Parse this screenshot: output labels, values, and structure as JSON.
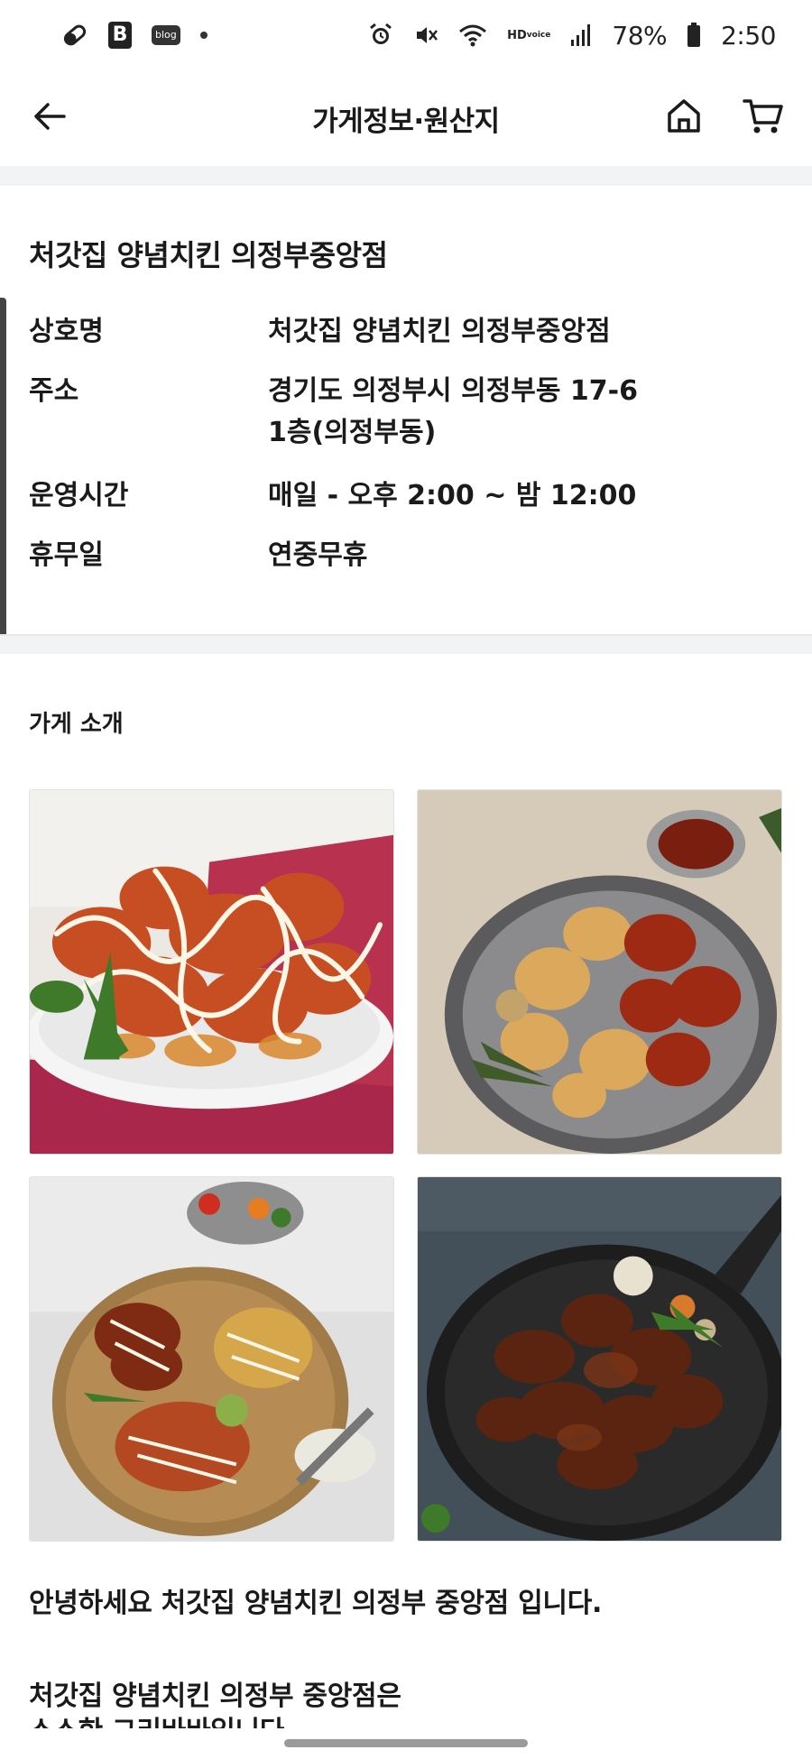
{
  "status_bar": {
    "left_icons": [
      "pill-icon",
      "b-app-icon",
      "blog-icon",
      "dot-icon"
    ],
    "b_label": "B",
    "blog_label": "blog",
    "hd_label": "HD",
    "voice_label": "voice",
    "battery": "78%",
    "time": "2:50"
  },
  "header": {
    "title": "가게정보·원산지"
  },
  "store": {
    "name_heading": "처갓집 양념치킨 의정부중앙점",
    "rows": [
      {
        "label": "상호명",
        "value": "처갓집 양념치킨 의정부중앙점"
      },
      {
        "label": "주소",
        "value": "경기도 의정부시 의정부동 17-6",
        "value2": "1층(의정부동)"
      },
      {
        "label": "운영시간",
        "value": "매일 - 오후 2:00 ~ 밤 12:00"
      },
      {
        "label": "휴무일",
        "value": "연중무휴"
      }
    ]
  },
  "intro": {
    "heading": "가게 소개",
    "line1": "안녕하세요 처갓집 양념치킨 의정부 중앙점 입니다.",
    "line2": "처갓집 양념치킨 의정부 중앙점은",
    "line3": "소소한 그리바바입니다"
  },
  "colors": {
    "accent_divider": "#f2f3f5",
    "text": "#1a1a1a"
  }
}
